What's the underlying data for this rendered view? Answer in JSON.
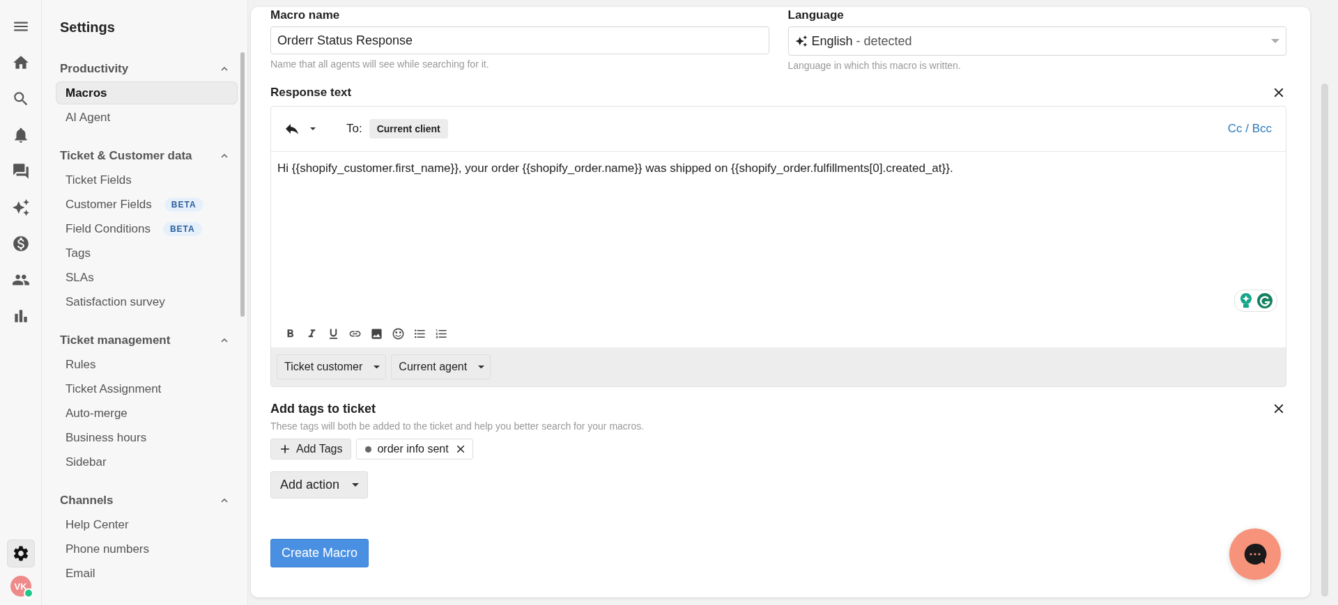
{
  "rail": {
    "items": [
      {
        "selected": false
      },
      {
        "selected": false
      },
      {
        "selected": false
      },
      {
        "selected": false
      },
      {
        "selected": false
      },
      {
        "selected": false
      },
      {
        "selected": false
      },
      {
        "selected": false
      },
      {
        "selected": false
      },
      {
        "selected": true
      }
    ],
    "avatar": {
      "initials": "VK",
      "online": true
    }
  },
  "sidebar": {
    "title": "Settings",
    "sections": [
      {
        "title": "Productivity",
        "expanded": true,
        "items": [
          {
            "label": "Macros",
            "selected": true
          },
          {
            "label": "AI Agent",
            "selected": false
          }
        ]
      },
      {
        "title": "Ticket & Customer data",
        "expanded": true,
        "items": [
          {
            "label": "Ticket Fields",
            "selected": false
          },
          {
            "label": "Customer Fields",
            "selected": false,
            "badge": "BETA"
          },
          {
            "label": "Field Conditions",
            "selected": false,
            "badge": "BETA"
          },
          {
            "label": "Tags",
            "selected": false
          },
          {
            "label": "SLAs",
            "selected": false
          },
          {
            "label": "Satisfaction survey",
            "selected": false
          }
        ]
      },
      {
        "title": "Ticket management",
        "expanded": true,
        "items": [
          {
            "label": "Rules",
            "selected": false
          },
          {
            "label": "Ticket Assignment",
            "selected": false
          },
          {
            "label": "Auto-merge",
            "selected": false
          },
          {
            "label": "Business hours",
            "selected": false
          },
          {
            "label": "Sidebar",
            "selected": false
          }
        ]
      },
      {
        "title": "Channels",
        "expanded": true,
        "items": [
          {
            "label": "Help Center",
            "selected": false
          },
          {
            "label": "Phone numbers",
            "selected": false
          },
          {
            "label": "Email",
            "selected": false
          }
        ]
      }
    ]
  },
  "macro_name": {
    "label": "Macro name",
    "value": "Orderr Status Response",
    "help": "Name that all agents will see while searching for it."
  },
  "language": {
    "label": "Language",
    "value": "English",
    "note": "- detected",
    "help": "Language in which this macro is written."
  },
  "response": {
    "title": "Response text",
    "to_label": "To:",
    "recipient": "Current client",
    "cc_link": "Cc / Bcc",
    "body": "Hi {{shopify_customer.first_name}}, your order {{shopify_order.name}} was shipped on {{shopify_order.fulfillments[0].created_at}}.",
    "variable_menus": [
      "Ticket customer",
      "Current agent"
    ]
  },
  "tags": {
    "title": "Add tags to ticket",
    "help": "These tags will both be added to the ticket and help you better search for your macros.",
    "add_button": "Add Tags",
    "items": [
      {
        "label": "order info sent"
      }
    ]
  },
  "add_action": "Add action",
  "submit": "Create Macro"
}
